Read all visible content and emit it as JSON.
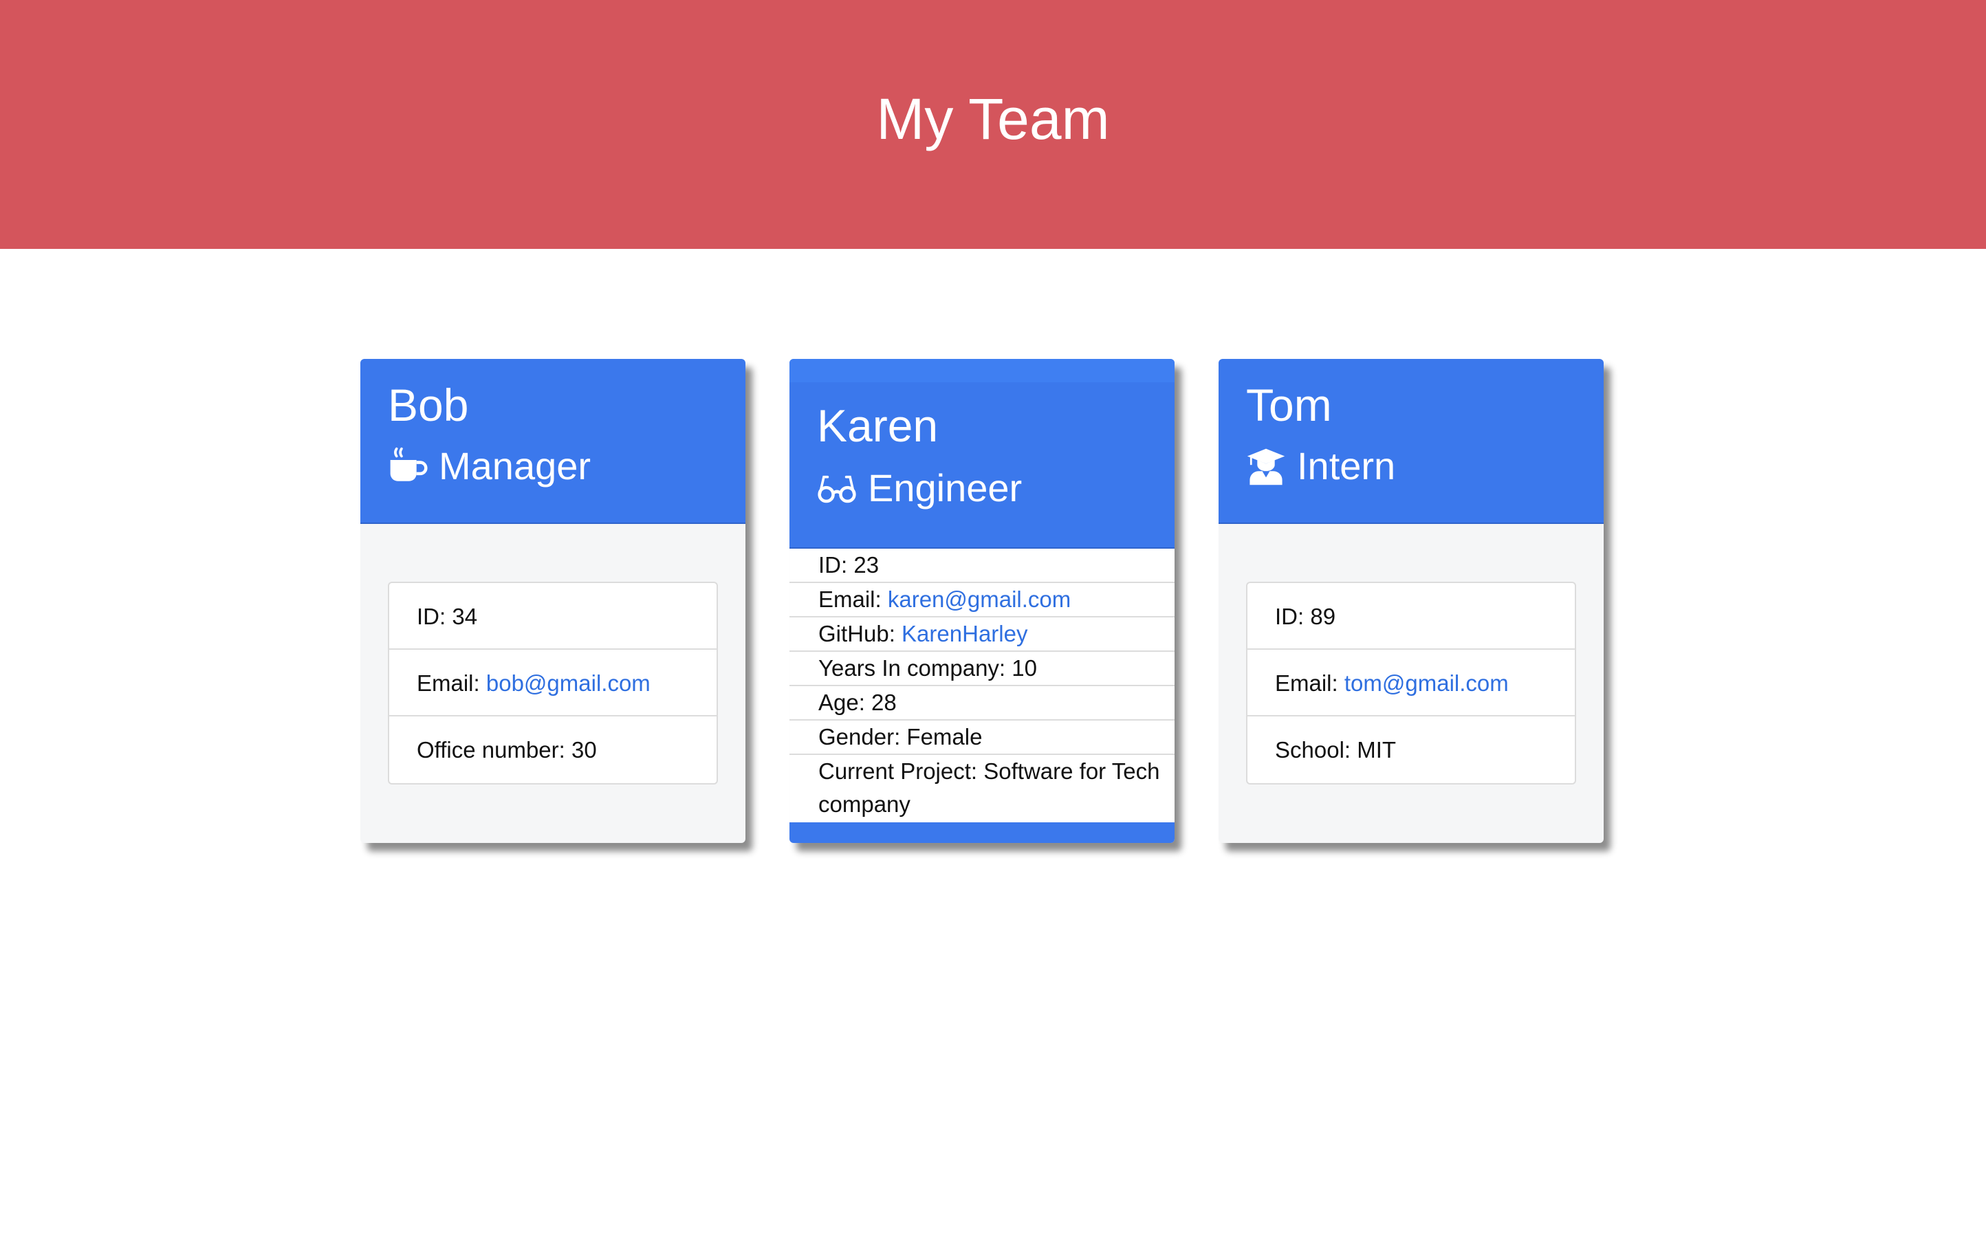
{
  "header": {
    "title": "My Team",
    "color": "#d4555c"
  },
  "accent": "#3b78ec",
  "team": [
    {
      "name": "Bob",
      "role": "Manager",
      "icon": "mug-icon",
      "id_label": "ID: 34",
      "email_prefix": "Email: ",
      "email": "bob@gmail.com",
      "extra": "Office number: 30"
    },
    {
      "name": "Karen",
      "role": "Engineer",
      "icon": "glasses-icon",
      "id_label": "ID: 23",
      "email_prefix": "Email: ",
      "email": "karen@gmail.com",
      "github_prefix": "GitHub: ",
      "github": "KarenHarley",
      "years": "Years In company: 10",
      "age": "Age: 28",
      "gender": "Gender: Female",
      "project": "Current Project: Software for Tech company"
    },
    {
      "name": "Tom",
      "role": "Intern",
      "icon": "graduate-icon",
      "id_label": "ID: 89",
      "email_prefix": "Email: ",
      "email": "tom@gmail.com",
      "extra": "School: MIT"
    }
  ]
}
